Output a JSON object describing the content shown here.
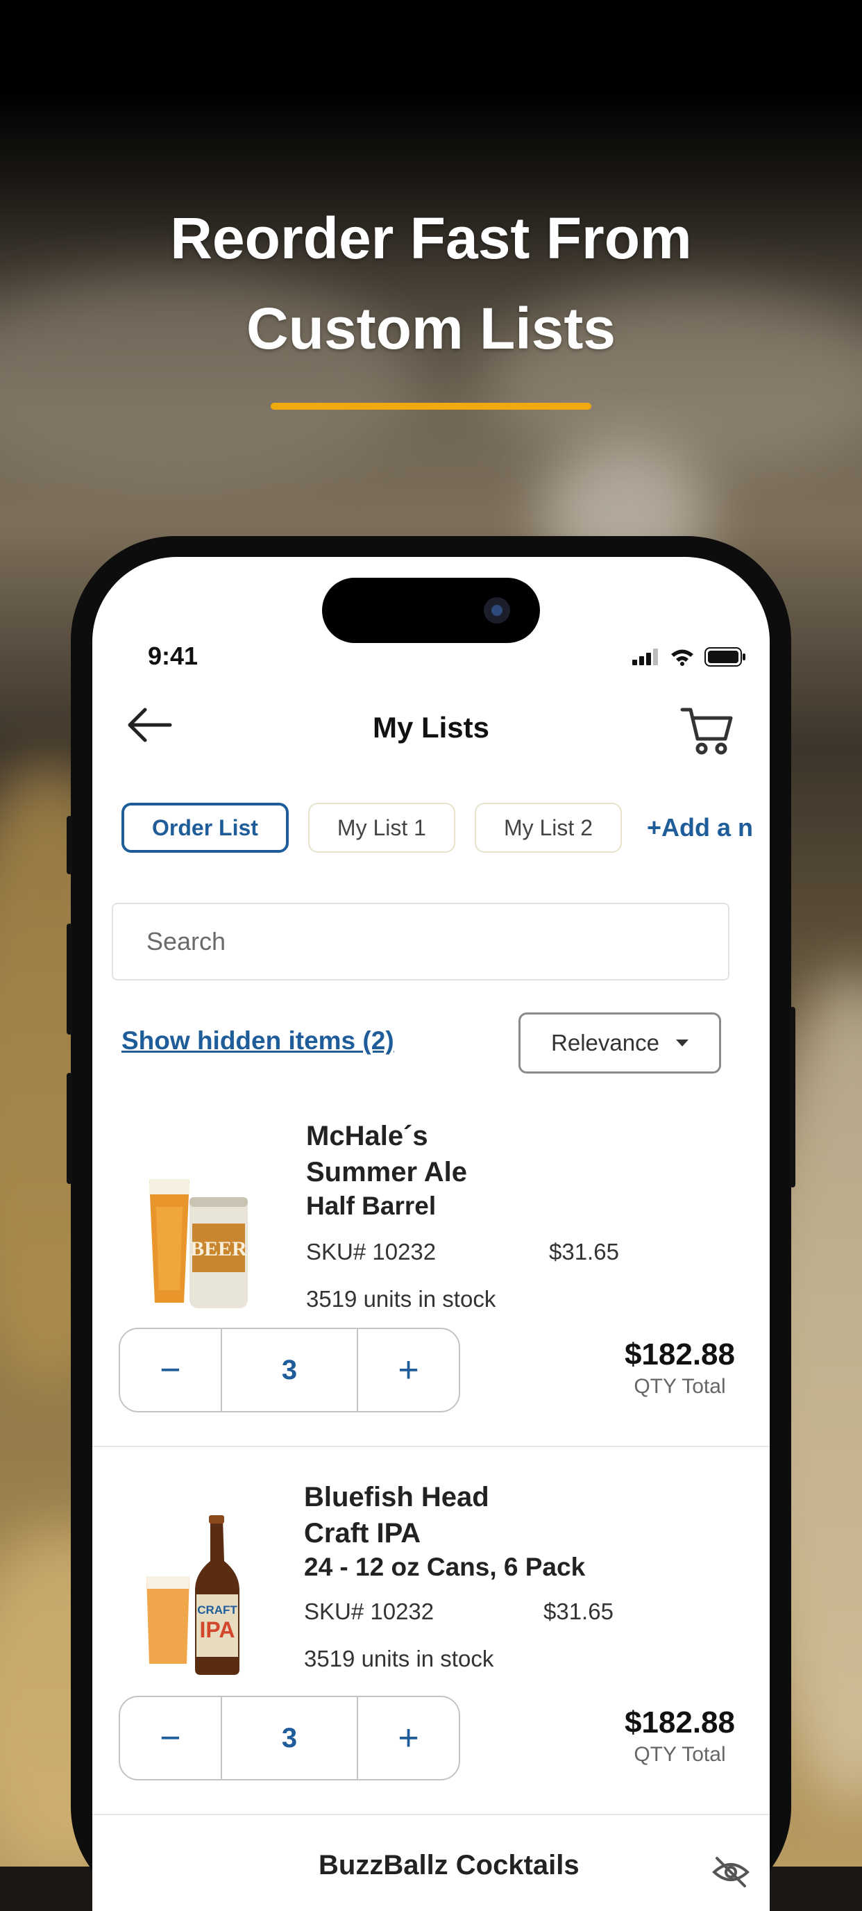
{
  "headline": {
    "line1": "Reorder Fast From",
    "line2": "Custom Lists"
  },
  "colors": {
    "accent": "#f0a90f",
    "brand_blue": "#1f5d9a"
  },
  "status": {
    "time": "9:41"
  },
  "header": {
    "title": "My Lists",
    "back_icon": "arrow-left-icon",
    "cart_icon": "cart-icon"
  },
  "tabs": [
    {
      "label": "Order List",
      "active": true
    },
    {
      "label": "My List 1",
      "active": false
    },
    {
      "label": "My List 2",
      "active": false
    }
  ],
  "add_list_label": "+Add a n",
  "search": {
    "placeholder": "Search"
  },
  "hidden_items_link": "Show hidden items (2)",
  "sort": {
    "selected": "Relevance"
  },
  "items": [
    {
      "name_line1": "McHale´s",
      "name_line2": "Summer Ale",
      "variant": "Half Barrel",
      "sku": "SKU# 10232",
      "price": "$31.65",
      "stock": "3519 units in stock",
      "qty": "3",
      "total": "$182.88",
      "total_label": "QTY Total",
      "can_label": "BEER"
    },
    {
      "name_line1": "Bluefish Head",
      "name_line2": "Craft IPA",
      "variant": "24 - 12 oz Cans, 6 Pack",
      "sku": "SKU# 10232",
      "price": "$31.65",
      "stock": "3519 units in stock",
      "qty": "3",
      "total": "$182.88",
      "total_label": "QTY Total",
      "bottle_label_1": "CRAFT",
      "bottle_label_2": "IPA"
    }
  ],
  "next_item_name": "BuzzBallz Cocktails",
  "stepper": {
    "minus": "−",
    "plus": "+"
  }
}
